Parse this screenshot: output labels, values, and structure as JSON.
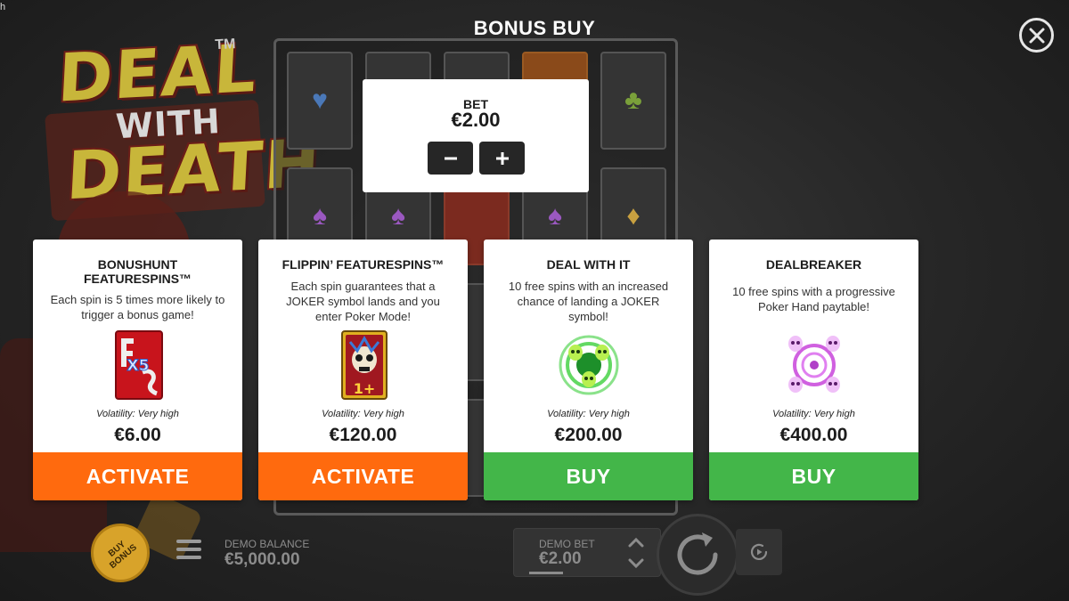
{
  "corner_glyph": "h",
  "header": {
    "title": "BONUS BUY"
  },
  "logo": {
    "line1": "DEAL",
    "line2": "WITH",
    "line3": "DEATH",
    "tm": "TM"
  },
  "bet_panel": {
    "label": "BET",
    "value": "€2.00",
    "minus_icon": "minus-icon",
    "plus_icon": "plus-icon"
  },
  "cards": [
    {
      "title": "BONUSHUNT\nFEATURESPINS™",
      "description": "Each spin is 5 times more likely to\ntrigger a bonus game!",
      "icon": "fx5-card-icon",
      "volatility": "Volatility: Very high",
      "price": "€6.00",
      "button": "ACTIVATE",
      "button_color": "#ff6a0e"
    },
    {
      "title": "FLIPPIN’ FEATURESPINS™",
      "description": "Each spin guarantees that a\nJOKER symbol lands and you\nenter Poker Mode!",
      "icon": "joker-skull-card-icon",
      "volatility": "Volatility: Very high",
      "price": "€120.00",
      "button": "ACTIVATE",
      "button_color": "#ff6a0e"
    },
    {
      "title": "DEAL WITH IT",
      "description": "10 free spins with an increased\nchance of landing a JOKER\nsymbol!",
      "icon": "green-skull-vortex-icon",
      "volatility": "Volatility: Very high",
      "price": "€200.00",
      "button": "BUY",
      "button_color": "#43b649"
    },
    {
      "title": "DEALBREAKER",
      "description": "10 free spins with a progressive\nPoker Hand paytable!",
      "icon": "purple-skull-vortex-icon",
      "volatility": "Volatility: Very high",
      "price": "€400.00",
      "button": "BUY",
      "button_color": "#43b649"
    }
  ],
  "bottom_bar": {
    "buy_bonus": "BUY\nBONUS",
    "demo_balance_label": "DEMO BALANCE",
    "demo_balance_value": "€5,000.00",
    "demo_bet_label": "DEMO BET",
    "demo_bet_value": "€2.00"
  },
  "colors": {
    "activate": "#ff6a0e",
    "buy": "#43b649",
    "panel": "#ffffff",
    "background": "#262626"
  }
}
